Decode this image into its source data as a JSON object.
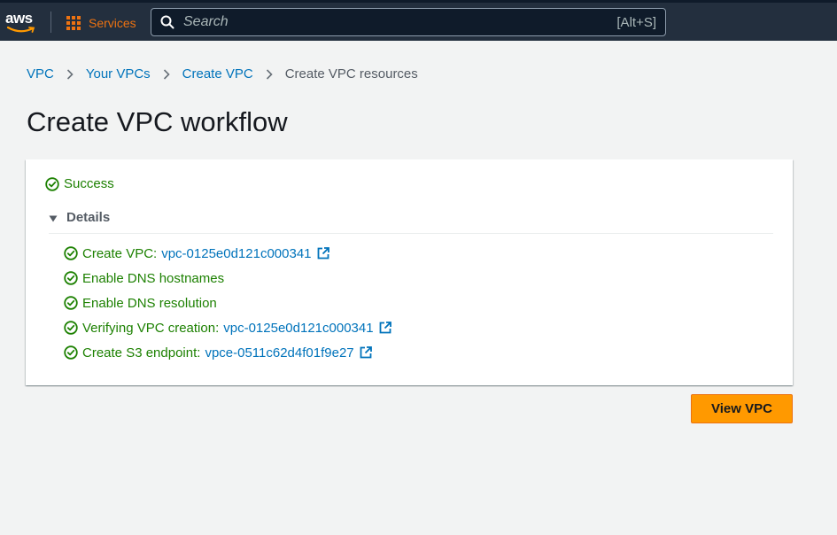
{
  "nav": {
    "logo_text": "aws",
    "services_label": "Services",
    "search_placeholder": "Search",
    "search_shortcut": "[Alt+S]",
    "brand_color": "#ec7211"
  },
  "breadcrumb": {
    "items": [
      "VPC",
      "Your VPCs",
      "Create VPC"
    ],
    "current": "Create VPC resources"
  },
  "page": {
    "title": "Create VPC workflow"
  },
  "status": {
    "text": "Success",
    "icon": "check-circle-icon",
    "color": "#1d8102"
  },
  "details": {
    "label": "Details",
    "expanded": true,
    "steps": [
      {
        "text": "Create VPC:",
        "link": "vpc-0125e0d121c000341",
        "external": true
      },
      {
        "text": "Enable DNS hostnames",
        "link": "",
        "external": false
      },
      {
        "text": "Enable DNS resolution",
        "link": "",
        "external": false
      },
      {
        "text": "Verifying VPC creation:",
        "link": "vpc-0125e0d121c000341",
        "external": true
      },
      {
        "text": "Create S3 endpoint:",
        "link": "vpce-0511c62d4f01f9e27",
        "external": true
      }
    ]
  },
  "actions": {
    "view_vpc_label": "View VPC",
    "primary_color": "#ff9900"
  }
}
